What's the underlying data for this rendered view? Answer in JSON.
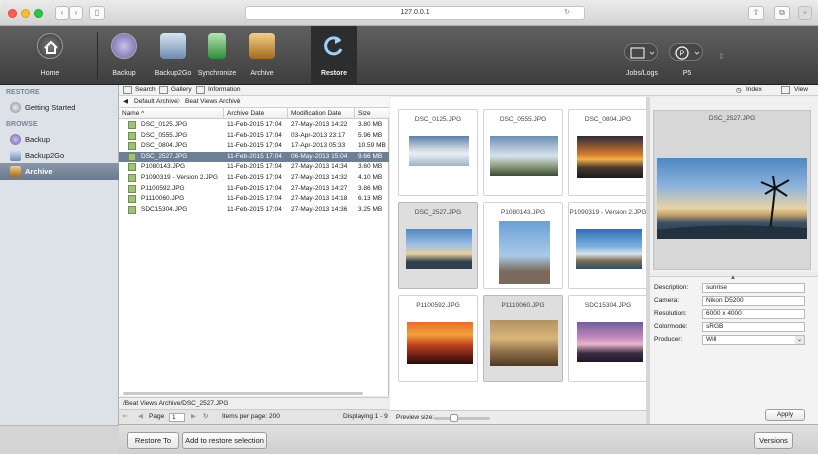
{
  "browser": {
    "url": "127.0.0.1"
  },
  "toolbar": {
    "home": "Home",
    "tools": [
      "Backup",
      "Backup2Go",
      "Synchronize",
      "Archive"
    ],
    "restore": "Restore",
    "jobs": "Jobs/Logs",
    "p5": "P5"
  },
  "sidebar": {
    "restore_header": "RESTORE",
    "getting_started": "Getting Started",
    "browse_header": "BROWSE",
    "items": [
      "Backup",
      "Backup2Go",
      "Archive"
    ]
  },
  "subtoolbar": {
    "search": "Search",
    "gallery": "Gallery",
    "information": "Information",
    "index": "Index",
    "view": "View"
  },
  "breadcrumb": {
    "root": "Default Archive",
    "current": "Beat Views Archive"
  },
  "table": {
    "headers": [
      "Name",
      "Archive Date",
      "Modification Date",
      "Size"
    ],
    "rows": [
      {
        "name": "DSC_0125.JPG",
        "archive": "11-Feb-2015 17:04",
        "mod": "27-May-2013 14:22",
        "size": "3.80 MB"
      },
      {
        "name": "DSC_0555.JPG",
        "archive": "11-Feb-2015 17:04",
        "mod": "03-Apr-2013 23:17",
        "size": "5.96 MB"
      },
      {
        "name": "DSC_0804.JPG",
        "archive": "11-Feb-2015 17:04",
        "mod": "17-Apr-2013 05:33",
        "size": "10.59 MB"
      },
      {
        "name": "DSC_2527.JPG",
        "archive": "11-Feb-2015 17:04",
        "mod": "06-May-2013 15:04",
        "size": "9.66 MB"
      },
      {
        "name": "P1080143.JPG",
        "archive": "11-Feb-2015 17:04",
        "mod": "27-May-2013 14:34",
        "size": "3.60 MB"
      },
      {
        "name": "P1090319 - Version 2.JPG",
        "archive": "11-Feb-2015 17:04",
        "mod": "27-May-2013 14:32",
        "size": "4.10 MB"
      },
      {
        "name": "P1100592.JPG",
        "archive": "11-Feb-2015 17:04",
        "mod": "27-May-2013 14:27",
        "size": "3.86 MB"
      },
      {
        "name": "P1110060.JPG",
        "archive": "11-Feb-2015 17:04",
        "mod": "27-May-2013 14:18",
        "size": "6.13 MB"
      },
      {
        "name": "SDC15304.JPG",
        "archive": "11-Feb-2015 17:04",
        "mod": "27-May-2013 14:36",
        "size": "3.25 MB"
      }
    ]
  },
  "path": "/Beat Views Archive/DSC_2527.JPG",
  "pager": {
    "page_label": "Page",
    "page": "1",
    "per_page": "Items per page: 200",
    "displaying": "Displaying 1 - 9"
  },
  "gallery": {
    "tiles": [
      "DSC_0125.JPG",
      "DSC_0555.JPG",
      "DSC_0804.JPG",
      "DSC_2527.JPG",
      "P1080143.JPG",
      "P1090319 - Version 2.JPG",
      "P1100592.JPG",
      "P1110060.JPG",
      "SDC15304.JPG"
    ]
  },
  "preview_size_label": "Preview size:",
  "preview": {
    "title": "DSC_2527.JPG"
  },
  "metadata": {
    "labels": [
      "Description:",
      "Camera:",
      "Resolution:",
      "Colormode:",
      "Producer:"
    ],
    "values": [
      "sunrise",
      "Nikon D5200",
      "6000 x 4000",
      "sRGB",
      "Will"
    ]
  },
  "buttons": {
    "apply": "Apply",
    "restore_to": "Restore To",
    "add": "Add to restore selection",
    "versions": "Versions"
  }
}
